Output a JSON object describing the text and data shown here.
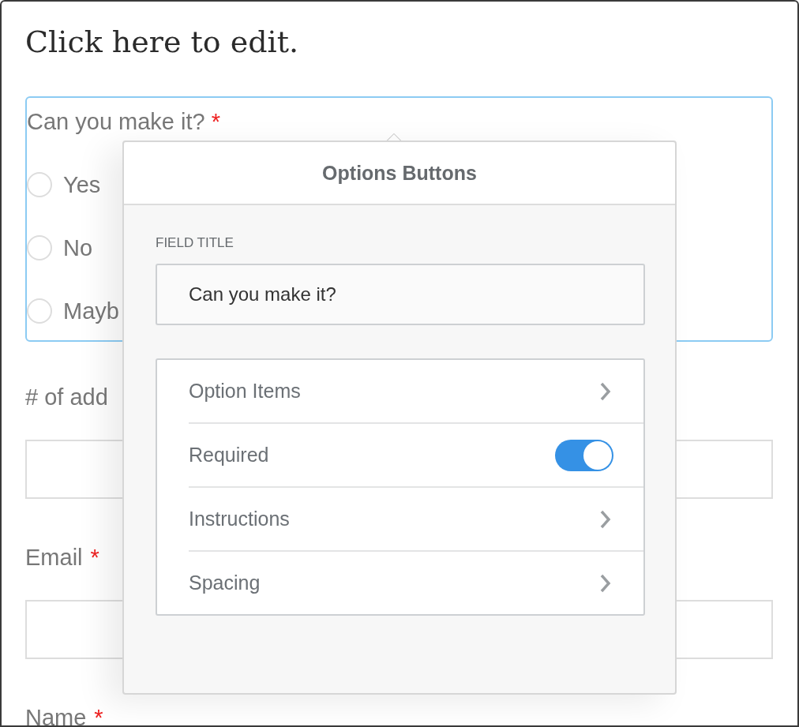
{
  "heading": "Click here to edit.",
  "question": {
    "label": "Can you make it?",
    "mark": "*",
    "options": [
      {
        "label": "Yes",
        "selected": false
      },
      {
        "label": "No",
        "selected": false
      },
      {
        "label": "Mayb",
        "selected": false
      }
    ]
  },
  "fields": [
    {
      "label": "# of add"
    },
    {
      "label": "Email",
      "mark": "*"
    },
    {
      "label": "Name",
      "mark": "*"
    }
  ],
  "popover": {
    "title": "Options Buttons",
    "field_title_label": "FIELD TITLE",
    "field_title_value": "Can you make it?",
    "items": [
      {
        "kind": "link",
        "label": "Option Items"
      },
      {
        "kind": "toggle",
        "label": "Required",
        "on": true
      },
      {
        "kind": "link",
        "label": "Instructions"
      },
      {
        "kind": "link",
        "label": "Spacing"
      }
    ]
  }
}
